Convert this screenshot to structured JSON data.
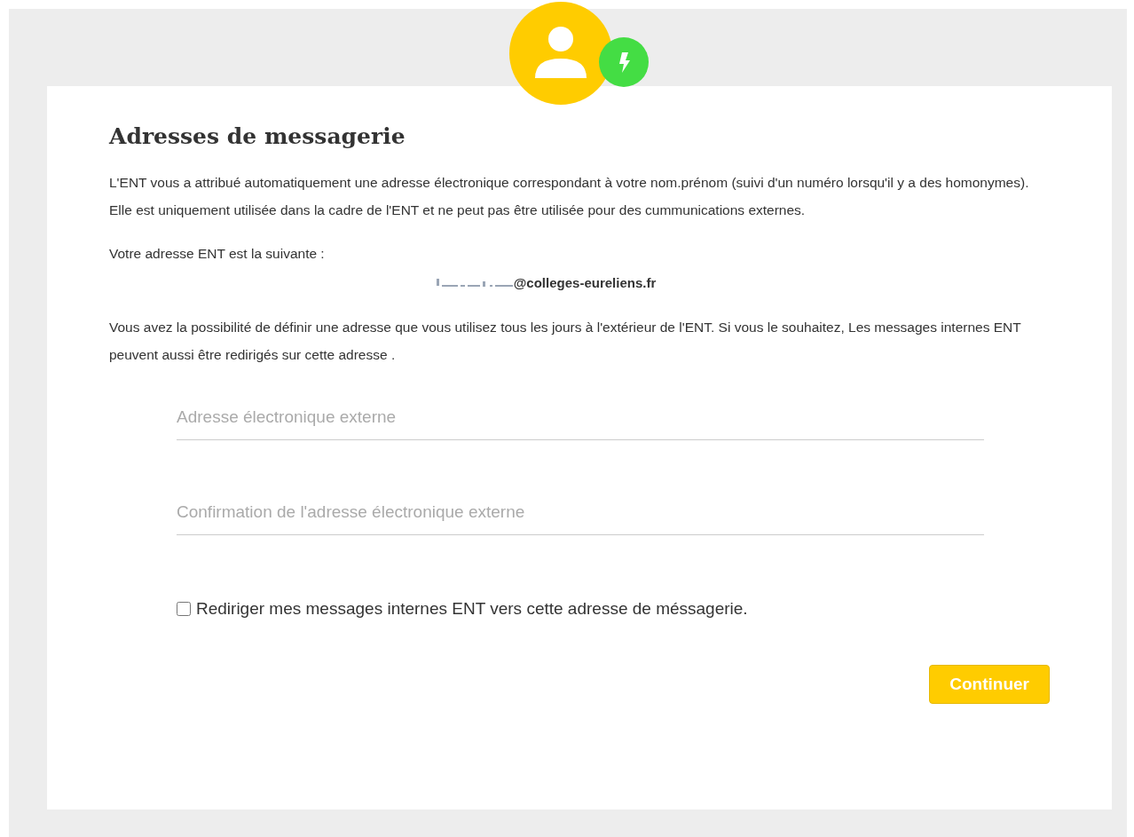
{
  "title": "Adresses de messagerie",
  "intro": "L'ENT vous a attribué automatiquement une adresse électronique correspondant à votre nom.prénom (suivi d'un numéro lorsqu'il y a des homonymes). Elle est uniquement utilisée dans la cadre de l'ENT et ne peut pas être utilisée pour des cummunications externes.",
  "address_label": "Votre adresse ENT est la suivante :",
  "address": {
    "redacted": true,
    "domain": "@colleges-eureliens.fr"
  },
  "explanation": "Vous avez la possibilité de définir une adresse que vous utilisez tous les jours à l'extérieur de l'ENT. Si vous le souhaitez, Les messages internes ENT peuvent aussi être redirigés sur cette adresse .",
  "fields": [
    {
      "placeholder": "Adresse électronique externe"
    },
    {
      "placeholder": "Confirmation de l'adresse électronique externe"
    }
  ],
  "redirect": {
    "label": "Rediriger mes messages internes ENT vers cette adresse de méssagerie.",
    "checked": false
  },
  "button": "Continuer"
}
